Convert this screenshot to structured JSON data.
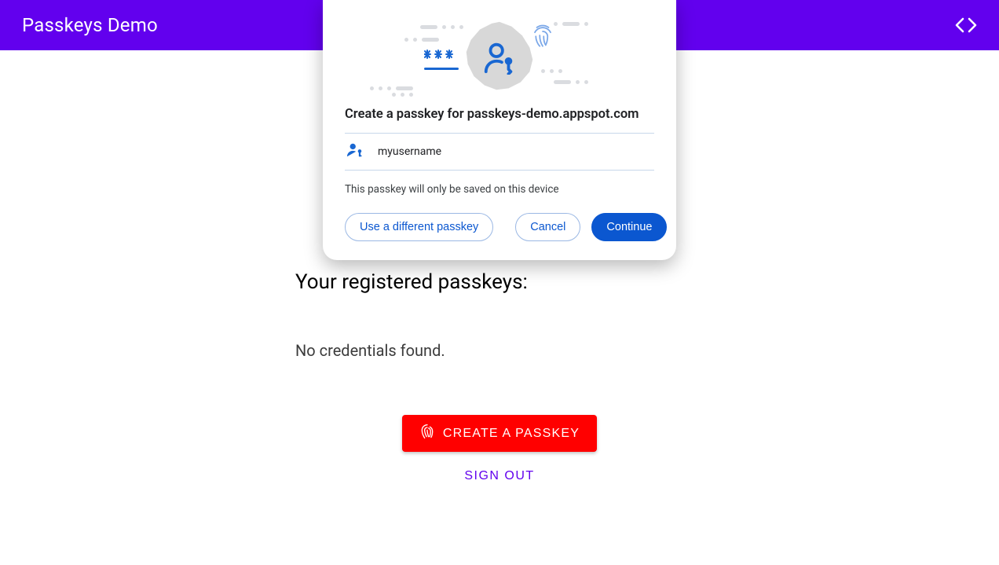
{
  "header": {
    "title": "Passkeys Demo"
  },
  "main": {
    "section_title": "Your registered passkeys:",
    "no_credentials": "No credentials found.",
    "create_label": "CREATE A PASSKEY",
    "signout_label": "SIGN OUT"
  },
  "modal": {
    "title": "Create a passkey for passkeys-demo.appspot.com",
    "username": "myusername",
    "note": "This passkey will only be saved on this device",
    "use_different": "Use a different passkey",
    "cancel": "Cancel",
    "continue": "Continue"
  },
  "colors": {
    "brand": "#6200ee",
    "google_blue": "#0b57d0",
    "danger": "#ff0000"
  }
}
